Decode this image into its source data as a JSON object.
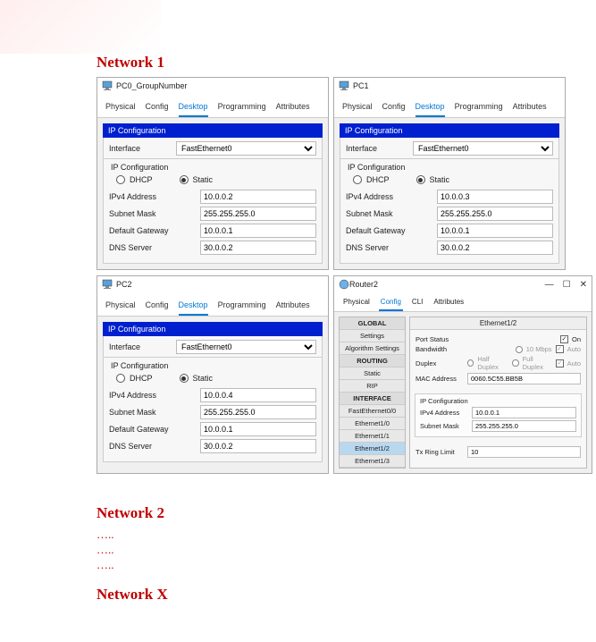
{
  "section1_title": "Network 1",
  "section2_title": "Network 2",
  "sectionX_title": "Network X",
  "dots": "…..",
  "tabs": {
    "physical": "Physical",
    "config": "Config",
    "desktop": "Desktop",
    "programming": "Programming",
    "attributes": "Attributes"
  },
  "label": {
    "ipcfg": "IP Configuration",
    "interface": "Interface",
    "dhcp": "DHCP",
    "static": "Static",
    "ipv4": "IPv4 Address",
    "mask": "Subnet Mask",
    "gw": "Default Gateway",
    "dns": "DNS Server"
  },
  "pc0": {
    "title": "PC0_GroupNumber",
    "interface": "FastEthernet0",
    "ipv4": "10.0.0.2",
    "mask": "255.255.255.0",
    "gw": "10.0.0.1",
    "dns": "30.0.0.2"
  },
  "pc1": {
    "title": "PC1",
    "interface": "FastEthernet0",
    "ipv4": "10.0.0.3",
    "mask": "255.255.255.0",
    "gw": "10.0.0.1",
    "dns": "30.0.0.2"
  },
  "pc2": {
    "title": "PC2",
    "interface": "FastEthernet0",
    "ipv4": "10.0.0.4",
    "mask": "255.255.255.0",
    "gw": "10.0.0.1",
    "dns": "30.0.0.2"
  },
  "router": {
    "title": "Router2",
    "tabs": {
      "physical": "Physical",
      "config": "Config",
      "cli": "CLI",
      "attributes": "Attributes"
    },
    "side": {
      "global": "GLOBAL",
      "settings": "Settings",
      "algo": "Algorithm Settings",
      "routing": "ROUTING",
      "static": "Static",
      "rip": "RIP",
      "interface": "INTERFACE",
      "fe00": "FastEthernet0/0",
      "e10": "Ethernet1/0",
      "e11": "Ethernet1/1",
      "e12": "Ethernet1/2",
      "e13": "Ethernet1/3"
    },
    "main": {
      "title": "Ethernet1/2",
      "portstatus": "Port Status",
      "on": "On",
      "bandwidth": "Bandwidth",
      "bw_val": "10 Mbps",
      "auto": "Auto",
      "duplex": "Duplex",
      "half": "Half Duplex",
      "full": "Full Duplex",
      "mac": "MAC Address",
      "mac_val": "0060.5C55.BB5B",
      "ipcfg": "IP Configuration",
      "ipv4": "IPv4 Address",
      "ipv4_val": "10.0.0.1",
      "mask": "Subnet Mask",
      "mask_val": "255.255.255.0",
      "txring": "Tx Ring Limit",
      "txring_val": "10"
    }
  }
}
